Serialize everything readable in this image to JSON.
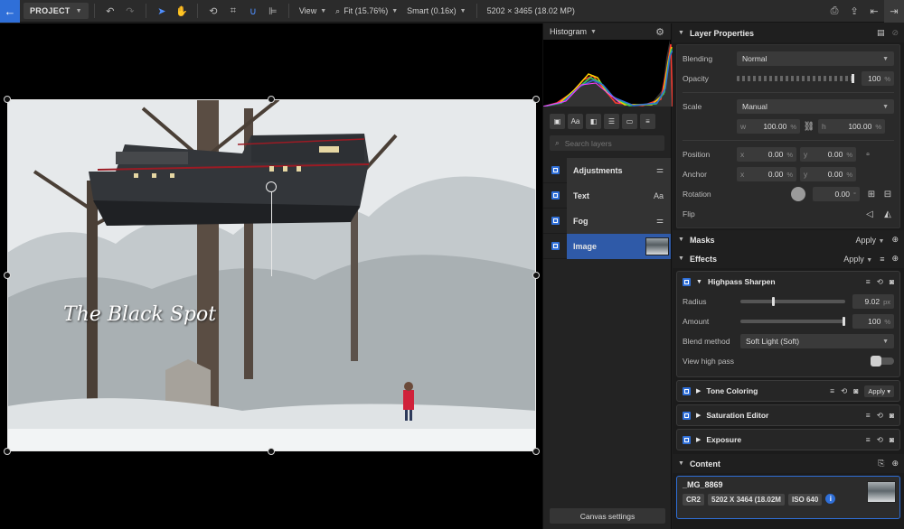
{
  "toolbar": {
    "project_label": "PROJECT",
    "view_label": "View",
    "fit_label": "Fit (15.76%)",
    "smart_label": "Smart (0.16x)",
    "image_info": "5202 × 3465 (18.02 MP)"
  },
  "canvas": {
    "watermark_text": "The Black Spot"
  },
  "histogram": {
    "title": "Histogram"
  },
  "layers": {
    "search_placeholder": "Search layers",
    "items": [
      {
        "name": "Adjustments",
        "icon": "sliders-icon"
      },
      {
        "name": "Text",
        "icon": "text-icon",
        "icon_text": "Aa"
      },
      {
        "name": "Fog",
        "icon": "sliders-icon"
      },
      {
        "name": "Image",
        "icon": "image-thumb"
      }
    ],
    "canvas_settings_label": "Canvas settings"
  },
  "layer_properties": {
    "title": "Layer Properties",
    "blending_label": "Blending",
    "blending_value": "Normal",
    "opacity_label": "Opacity",
    "opacity_value": "100",
    "opacity_unit": "%",
    "scale_label": "Scale",
    "scale_value": "Manual",
    "w_label": "w",
    "w_value": "100.00",
    "h_label": "h",
    "h_value": "100.00",
    "pct": "%",
    "position_label": "Position",
    "pos_x_label": "x",
    "pos_x_value": "0.00",
    "pos_y_label": "y",
    "pos_y_value": "0.00",
    "anchor_label": "Anchor",
    "anc_x_label": "x",
    "anc_x_value": "0.00",
    "anc_y_label": "y",
    "anc_y_value": "0.00",
    "rotation_label": "Rotation",
    "rotation_value": "0.00",
    "rotation_unit": "°",
    "flip_label": "Flip"
  },
  "masks": {
    "title": "Masks",
    "apply_label": "Apply"
  },
  "effects": {
    "title": "Effects",
    "apply_label": "Apply",
    "highpass": {
      "title": "Highpass Sharpen",
      "radius_label": "Radius",
      "radius_value": "9.02",
      "radius_unit": "px",
      "radius_fraction": 0.3,
      "amount_label": "Amount",
      "amount_value": "100",
      "amount_unit": "%",
      "blend_label": "Blend method",
      "blend_value": "Soft Light (Soft)",
      "view_label": "View high pass"
    },
    "tone_coloring": {
      "title": "Tone Coloring",
      "apply_label": "Apply"
    },
    "saturation_editor": {
      "title": "Saturation Editor"
    },
    "exposure": {
      "title": "Exposure"
    }
  },
  "content": {
    "title": "Content",
    "file_name": "_MG_8869",
    "badge_format": "CR2",
    "badge_size": "5202 X 3464 (18.02M",
    "badge_iso": "ISO 640",
    "info_icon": "i"
  },
  "colors": {
    "accent": "#2f6fd8",
    "active_layer": "#2f5aa8"
  }
}
